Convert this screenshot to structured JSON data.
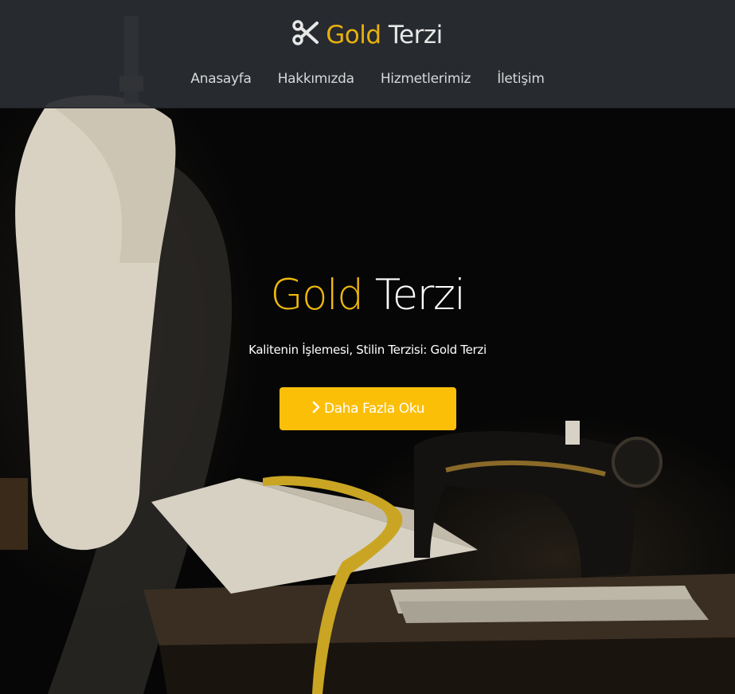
{
  "brand": {
    "name_accent": "Gold",
    "name_rest": "Terzi",
    "icon": "scissors-icon"
  },
  "nav": {
    "items": [
      {
        "label": "Anasayfa"
      },
      {
        "label": "Hakkımızda"
      },
      {
        "label": "Hizmetlerimiz"
      },
      {
        "label": "İletişim"
      }
    ]
  },
  "hero": {
    "title_accent": "Gold",
    "title_rest": "Terzi",
    "subtitle": "Kalitenin İşlemesi, Stilin Terzisi: Gold Terzi",
    "cta_label": "Daha Fazla Oku",
    "cta_icon": "chevron-right-icon"
  },
  "colors": {
    "accent": "#f0b90b",
    "button": "#fcbf08",
    "navbar": "#2a2d33",
    "nav_text": "#d8d8d8"
  }
}
